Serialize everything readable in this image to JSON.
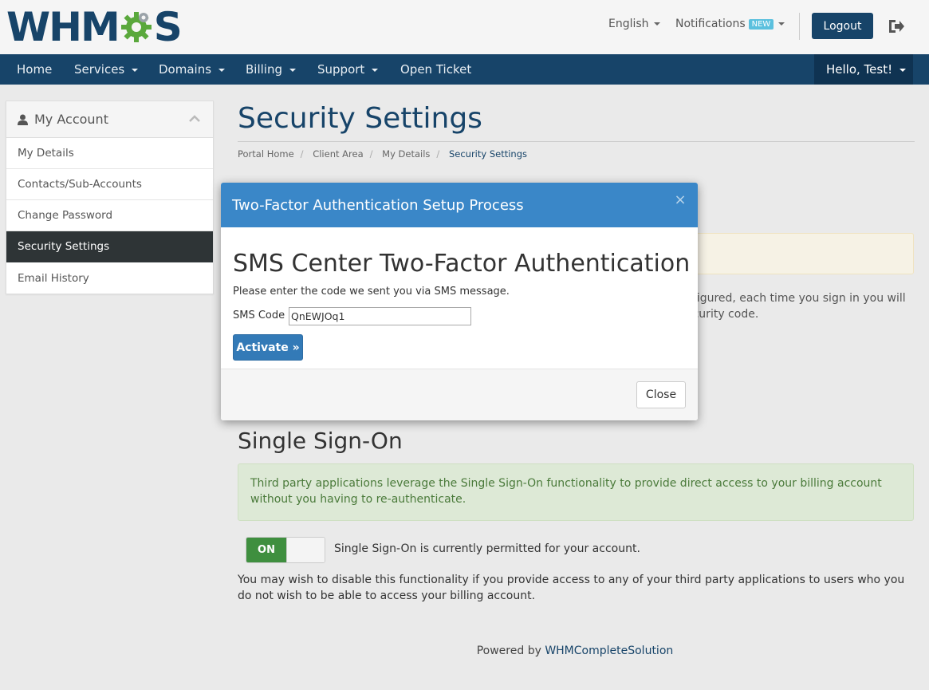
{
  "header": {
    "logo_text_left": "WHM",
    "logo_text_right": "S",
    "language": "English",
    "notifications": "Notifications",
    "notifications_badge": "NEW",
    "logout": "Logout"
  },
  "nav": {
    "items": [
      {
        "label": "Home",
        "dropdown": false
      },
      {
        "label": "Services",
        "dropdown": true
      },
      {
        "label": "Domains",
        "dropdown": true
      },
      {
        "label": "Billing",
        "dropdown": true
      },
      {
        "label": "Support",
        "dropdown": true
      },
      {
        "label": "Open Ticket",
        "dropdown": false
      }
    ],
    "user": "Hello, Test!"
  },
  "sidebar": {
    "title": "My Account",
    "items": [
      {
        "label": "My Details",
        "active": false
      },
      {
        "label": "Contacts/Sub-Accounts",
        "active": false
      },
      {
        "label": "Change Password",
        "active": false
      },
      {
        "label": "Security Settings",
        "active": true
      },
      {
        "label": "Email History",
        "active": false
      }
    ]
  },
  "main": {
    "title": "Security Settings",
    "breadcrumb": [
      "Portal Home",
      "Client Area",
      "My Details",
      "Security Settings"
    ],
    "behind_text_line1": "nfigured, each time you sign in you will",
    "behind_text_line2": "ecurity code.",
    "sso": {
      "title": "Single Sign-On",
      "info": "Third party applications leverage the Single Sign-On functionality to provide direct access to your billing account without you having to re-authenticate.",
      "toggle_on": "ON",
      "toggle_state": true,
      "status": "Single Sign-On is currently permitted for your account.",
      "note": "You may wish to disable this functionality if you provide access to any of your third party applications to users who you do not wish to be able to access your billing account."
    }
  },
  "footer": {
    "prefix": "Powered by ",
    "link": "WHMCompleteSolution"
  },
  "modal": {
    "title": "Two-Factor Authentication Setup Process",
    "close_x": "×",
    "heading": "SMS Center Two-Factor Authentication",
    "instruction": "Please enter the code we sent you via SMS message.",
    "sms_label": "SMS Code",
    "sms_value": "QnEWJOq1",
    "activate": "Activate »",
    "close": "Close"
  },
  "colors": {
    "brand": "#174469",
    "modal_header": "#3a87c8",
    "toggle_on": "#3f8f3f",
    "sidebar_active": "#2e3436"
  }
}
